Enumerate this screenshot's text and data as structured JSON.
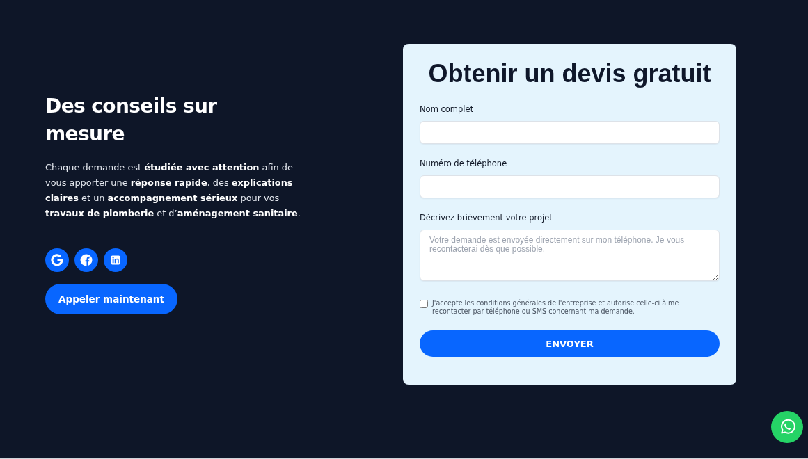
{
  "hero": {
    "heading": "Des conseils sur mesure",
    "text": "Chaque demande est **étudiée avec attention** afin de vous apporter une **réponse rapide**, des **explications claires** et un **accompagnement sérieux** pour vos **travaux de plomberie** et d’**aménagement sanitaire**.",
    "call_button": "Appeler maintenant"
  },
  "quote_form": {
    "title": "Obtenir un devis gratuit",
    "fields": [
      {
        "kind": "input",
        "label": "Nom complet"
      },
      {
        "kind": "input",
        "label": "Numéro de téléphone"
      },
      {
        "kind": "textarea",
        "label": "Décrivez brièvement votre projet",
        "placeholder": "Votre demande est envoyée directement sur mon téléphone. Je vous recontacterai dès que possible."
      }
    ],
    "consent": {
      "label": "J'accepte les conditions générales de l'entreprise et autorise celle-ci à me recontacter par téléphone ou SMS concernant ma demande.",
      "checked": false
    },
    "submit_button": "ENVOYER"
  }
}
